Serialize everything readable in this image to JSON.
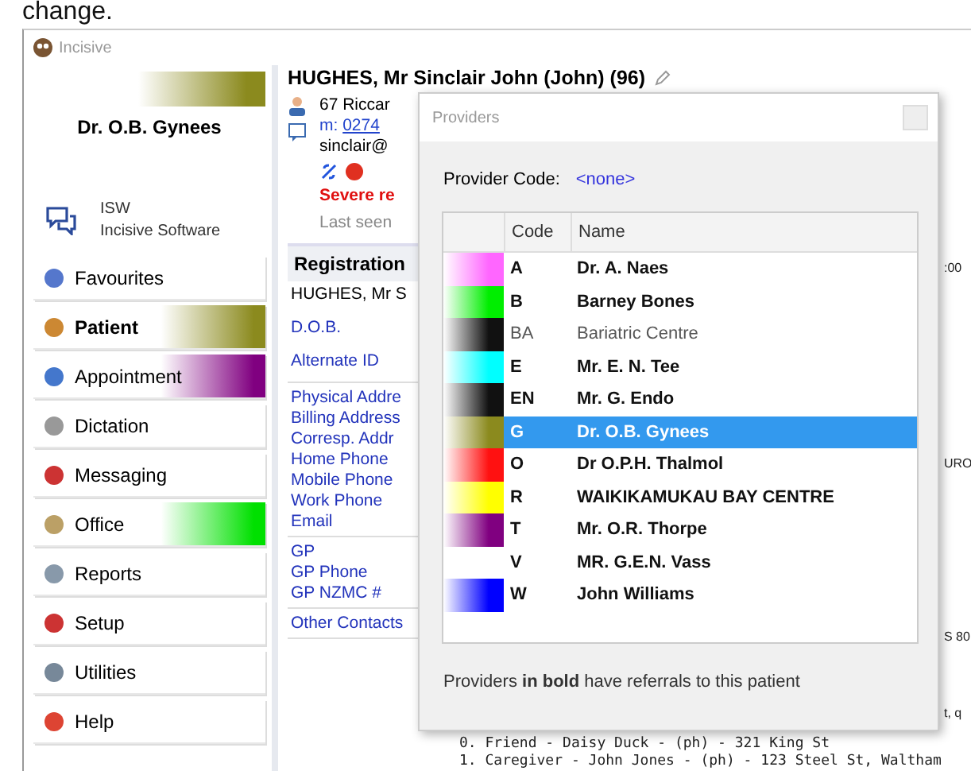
{
  "caption": "change.",
  "window": {
    "title": "Incisive"
  },
  "sidebar": {
    "provider": {
      "name": "Dr. O.B. Gynees",
      "color": "#8b8a1e"
    },
    "org": {
      "code": "ISW",
      "name": "Incisive Software"
    },
    "items": [
      {
        "label": "Favourites",
        "selected": false
      },
      {
        "label": "Patient",
        "selected": true,
        "color": "#8b8a1e"
      },
      {
        "label": "Appointment",
        "selected": false,
        "color": "#800080"
      },
      {
        "label": "Dictation",
        "selected": false
      },
      {
        "label": "Messaging",
        "selected": false
      },
      {
        "label": "Office",
        "selected": false,
        "color": "#00e000"
      },
      {
        "label": "Reports",
        "selected": false
      },
      {
        "label": "Setup",
        "selected": false
      },
      {
        "label": "Utilities",
        "selected": false
      },
      {
        "label": "Help",
        "selected": false
      }
    ]
  },
  "patient": {
    "name": "HUGHES, Mr Sinclair John (John) (96)",
    "address": "67 Riccar",
    "mobile_label": "m:",
    "mobile": "0274",
    "email": "sinclair@",
    "alert": "Severe re",
    "last_seen": "Last seen",
    "time": ":00"
  },
  "registration": {
    "title": "Registration",
    "name_line": "HUGHES, Mr S",
    "groups": [
      [
        "D.O.B.",
        "Alternate ID"
      ],
      [
        "Physical Addre",
        "Billing Address",
        "Corresp. Addr",
        "Home Phone",
        "Mobile Phone",
        "Work Phone",
        "Email"
      ],
      [
        "GP",
        "GP Phone",
        "GP NZMC #"
      ],
      [
        "Other Contacts"
      ]
    ],
    "fragments": [
      "URO",
      "S 80",
      "t, q"
    ],
    "contacts": [
      "0. Friend - Daisy Duck - (ph)  - 321 King St",
      "1. Caregiver - John Jones - (ph)  - 123 Steel St, Waltham"
    ]
  },
  "dialog": {
    "title": "Providers",
    "code_label": "Provider Code:",
    "code_value": "<none>",
    "columns": [
      "Code",
      "Name"
    ],
    "rows": [
      {
        "code": "A",
        "name": "Dr. A. Naes",
        "bold": true,
        "selected": false,
        "color": "#ff66ff"
      },
      {
        "code": "B",
        "name": "Barney Bones",
        "bold": true,
        "selected": false,
        "color": "#00ee00"
      },
      {
        "code": "BA",
        "name": "Bariatric Centre",
        "bold": false,
        "selected": false,
        "color": "#111111"
      },
      {
        "code": "E",
        "name": "Mr. E. N. Tee",
        "bold": true,
        "selected": false,
        "color": "#00ffff"
      },
      {
        "code": "EN",
        "name": "Mr. G. Endo",
        "bold": true,
        "selected": false,
        "color": "#111111"
      },
      {
        "code": "G",
        "name": "Dr. O.B. Gynees",
        "bold": true,
        "selected": true,
        "color": "#8b8a1e"
      },
      {
        "code": "O",
        "name": "Dr O.P.H. Thalmol",
        "bold": true,
        "selected": false,
        "color": "#ff1111"
      },
      {
        "code": "R",
        "name": "WAIKIKAMUKAU BAY CENTRE",
        "bold": true,
        "selected": false,
        "color": "#ffff00"
      },
      {
        "code": "T",
        "name": "Mr. O.R. Thorpe",
        "bold": true,
        "selected": false,
        "color": "#800080"
      },
      {
        "code": "V",
        "name": "MR. G.E.N. Vass",
        "bold": true,
        "selected": false
      },
      {
        "code": "W",
        "name": "John Williams",
        "bold": true,
        "selected": false,
        "color": "#0000ff"
      }
    ],
    "footer": "Providers **in bold** have referrals to this patient"
  }
}
